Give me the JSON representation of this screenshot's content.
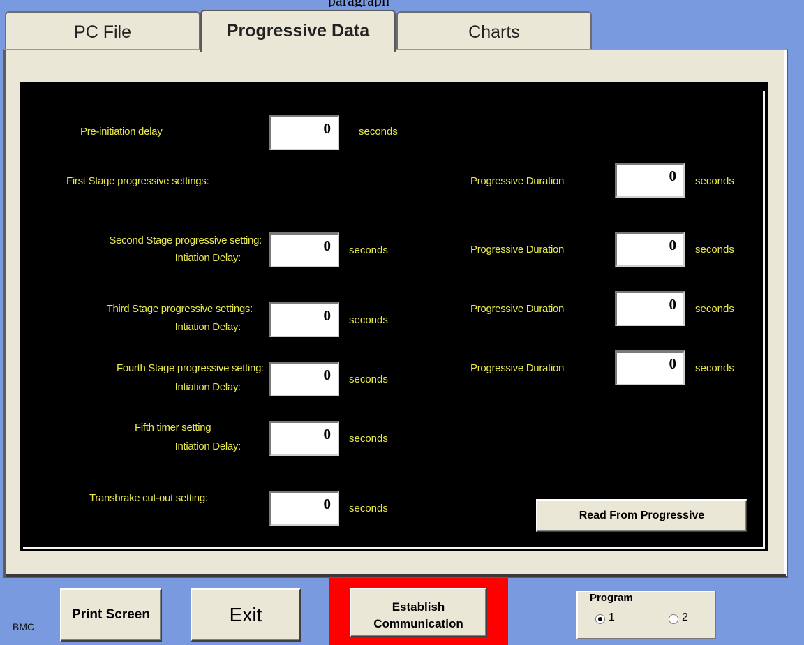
{
  "caption": "paragraph",
  "tabs": [
    {
      "label": "PC File"
    },
    {
      "label": "Progressive Data"
    },
    {
      "label": "Charts"
    }
  ],
  "unit": "seconds",
  "left_rows": [
    {
      "label1": "Pre-initiation delay",
      "label2": "",
      "value": "0"
    },
    {
      "label1": "First Stage progressive settings:",
      "label2": "",
      "value": null
    },
    {
      "label1": "Second Stage progressive setting:",
      "label2": "Intiation Delay:",
      "value": "0"
    },
    {
      "label1": "Third Stage progressive settings:",
      "label2": "Intiation Delay:",
      "value": "0"
    },
    {
      "label1": "Fourth Stage progressive setting:",
      "label2": "Intiation Delay:",
      "value": "0"
    },
    {
      "label1": "Fifth timer setting",
      "label2": "Intiation Delay:",
      "value": "0"
    },
    {
      "label1": "Transbrake cut-out setting:",
      "label2": "",
      "value": "0"
    }
  ],
  "right_rows": [
    {
      "label": "Progressive Duration",
      "value": "0"
    },
    {
      "label": "Progressive Duration",
      "value": "0"
    },
    {
      "label": "Progressive Duration",
      "value": "0"
    },
    {
      "label": "Progressive Duration",
      "value": "0"
    }
  ],
  "read_button": "Read From Progressive",
  "bottom": {
    "bmc": "BMC",
    "print_screen": "Print Screen",
    "exit": "Exit",
    "establish_line1": "Establish",
    "establish_line2": "Communication",
    "program_title": "Program",
    "program_options": [
      "1",
      "2"
    ],
    "program_selected": "1"
  }
}
